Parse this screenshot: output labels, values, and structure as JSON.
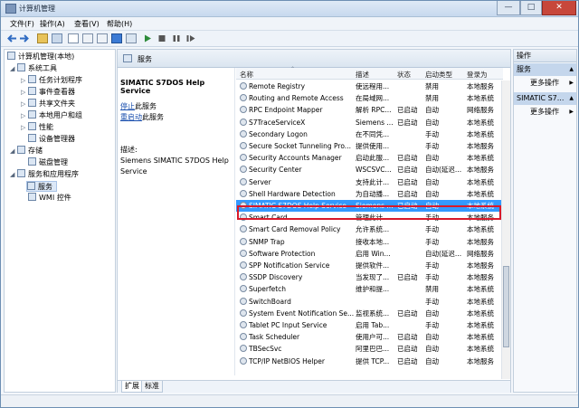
{
  "window": {
    "title": "计算机管理"
  },
  "menu": {
    "items": [
      "文件(F)",
      "操作(A)",
      "查看(V)",
      "帮助(H)"
    ]
  },
  "tree": {
    "items": [
      {
        "label": "计算机管理(本地)"
      },
      {
        "label": "系统工具"
      },
      {
        "label": "任务计划程序"
      },
      {
        "label": "事件查看器"
      },
      {
        "label": "共享文件夹"
      },
      {
        "label": "本地用户和组"
      },
      {
        "label": "性能"
      },
      {
        "label": "设备管理器"
      },
      {
        "label": "存储"
      },
      {
        "label": "磁盘管理"
      },
      {
        "label": "服务和应用程序"
      },
      {
        "label": "服务"
      },
      {
        "label": "WMI 控件"
      }
    ]
  },
  "center": {
    "title": "服务",
    "selected_name": "SIMATIC S7DOS Help Service",
    "stop_link": "停止",
    "stop_suffix": "此服务",
    "restart_link": "重启动",
    "restart_suffix": "此服务",
    "desc_label": "描述:",
    "desc_text": "Siemens SIMATIC S7DOS Help Service"
  },
  "columns": {
    "name": "名称",
    "desc": "描述",
    "status": "状态",
    "startup": "启动类型",
    "logon": "登录为"
  },
  "services": [
    {
      "name": "Remote Registry",
      "desc": "使远程用...",
      "status": "",
      "startup": "禁用",
      "logon": "本地服务"
    },
    {
      "name": "Routing and Remote Access",
      "desc": "在局域网...",
      "status": "",
      "startup": "禁用",
      "logon": "本地系统"
    },
    {
      "name": "RPC Endpoint Mapper",
      "desc": "解析 RPC...",
      "status": "已启动",
      "startup": "自动",
      "logon": "网络服务"
    },
    {
      "name": "S7TraceServiceX",
      "desc": "Siemens ...",
      "status": "已启动",
      "startup": "自动",
      "logon": "本地系统"
    },
    {
      "name": "Secondary Logon",
      "desc": "在不同凭...",
      "status": "",
      "startup": "手动",
      "logon": "本地系统"
    },
    {
      "name": "Secure Socket Tunneling Pro...",
      "desc": "提供使用...",
      "status": "",
      "startup": "手动",
      "logon": "本地服务"
    },
    {
      "name": "Security Accounts Manager",
      "desc": "启动此服...",
      "status": "已启动",
      "startup": "自动",
      "logon": "本地系统"
    },
    {
      "name": "Security Center",
      "desc": "WSCSVC...",
      "status": "已启动",
      "startup": "自动(延迟...",
      "logon": "本地服务"
    },
    {
      "name": "Server",
      "desc": "支持此计...",
      "status": "已启动",
      "startup": "自动",
      "logon": "本地系统"
    },
    {
      "name": "Shell Hardware Detection",
      "desc": "为自动播...",
      "status": "已启动",
      "startup": "自动",
      "logon": "本地系统"
    },
    {
      "name": "SIMATIC S7DOS Help Service",
      "desc": "Siemens ...",
      "status": "已启动",
      "startup": "自动",
      "logon": "本地系统"
    },
    {
      "name": "Smart Card",
      "desc": "管理此计...",
      "status": "",
      "startup": "手动",
      "logon": "本地服务"
    },
    {
      "name": "Smart Card Removal Policy",
      "desc": "允许系统...",
      "status": "",
      "startup": "手动",
      "logon": "本地系统"
    },
    {
      "name": "SNMP Trap",
      "desc": "接收本地...",
      "status": "",
      "startup": "手动",
      "logon": "本地服务"
    },
    {
      "name": "Software Protection",
      "desc": "启用 Win...",
      "status": "",
      "startup": "自动(延迟...",
      "logon": "网络服务"
    },
    {
      "name": "SPP Notification Service",
      "desc": "提供软件...",
      "status": "",
      "startup": "手动",
      "logon": "本地服务"
    },
    {
      "name": "SSDP Discovery",
      "desc": "当发现了...",
      "status": "已启动",
      "startup": "手动",
      "logon": "本地服务"
    },
    {
      "name": "Superfetch",
      "desc": "维护和提...",
      "status": "",
      "startup": "禁用",
      "logon": "本地系统"
    },
    {
      "name": "SwitchBoard",
      "desc": "",
      "status": "",
      "startup": "手动",
      "logon": "本地系统"
    },
    {
      "name": "System Event Notification Se...",
      "desc": "监视系统...",
      "status": "已启动",
      "startup": "自动",
      "logon": "本地系统"
    },
    {
      "name": "Tablet PC Input Service",
      "desc": "启用 Tab...",
      "status": "",
      "startup": "手动",
      "logon": "本地系统"
    },
    {
      "name": "Task Scheduler",
      "desc": "使用户可...",
      "status": "已启动",
      "startup": "自动",
      "logon": "本地系统"
    },
    {
      "name": "TBSecSvc",
      "desc": "阿里巴巴...",
      "status": "已启动",
      "startup": "自动",
      "logon": "本地系统"
    },
    {
      "name": "TCP/IP NetBIOS Helper",
      "desc": "提供 TCP...",
      "status": "已启动",
      "startup": "自动",
      "logon": "本地服务"
    }
  ],
  "tabs": [
    "扩展",
    "标准"
  ],
  "actions": {
    "header": "操作",
    "section1": "服务",
    "more1": "更多操作",
    "section2": "SIMATIC S7...",
    "more2": "更多操作"
  }
}
